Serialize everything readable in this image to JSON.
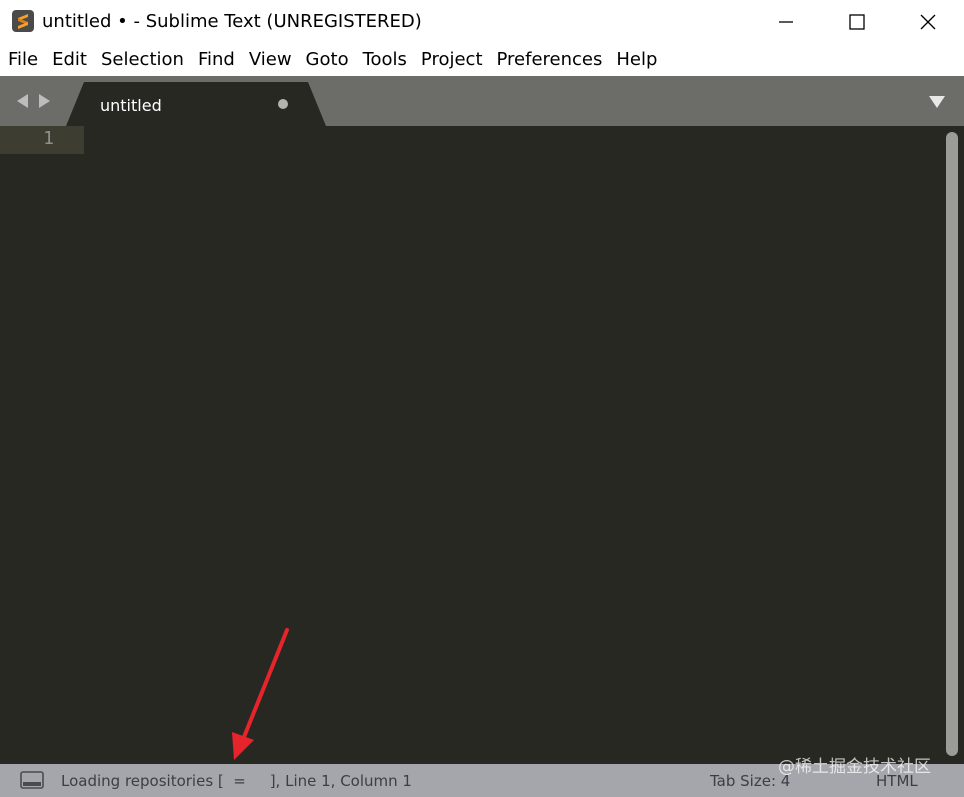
{
  "window": {
    "title": "untitled • - Sublime Text (UNREGISTERED)",
    "icon": "sublime-text-logo-icon"
  },
  "menu": {
    "items": [
      "File",
      "Edit",
      "Selection",
      "Find",
      "View",
      "Goto",
      "Tools",
      "Project",
      "Preferences",
      "Help"
    ]
  },
  "tabs": [
    {
      "label": "untitled",
      "dirty": true
    }
  ],
  "editor": {
    "line_numbers": [
      "1"
    ]
  },
  "status": {
    "message": "Loading repositories [  =     ], Line 1, Column 1",
    "tab_size": "Tab Size: 4",
    "syntax": "HTML"
  },
  "watermark": "@稀土掘金技术社区",
  "colors": {
    "editor_bg": "#272822",
    "tabbar_bg": "#6c6c69",
    "status_bg": "#a4a6ac",
    "accent_orange": "#f7a02a",
    "annotation_red": "#e5252b"
  }
}
